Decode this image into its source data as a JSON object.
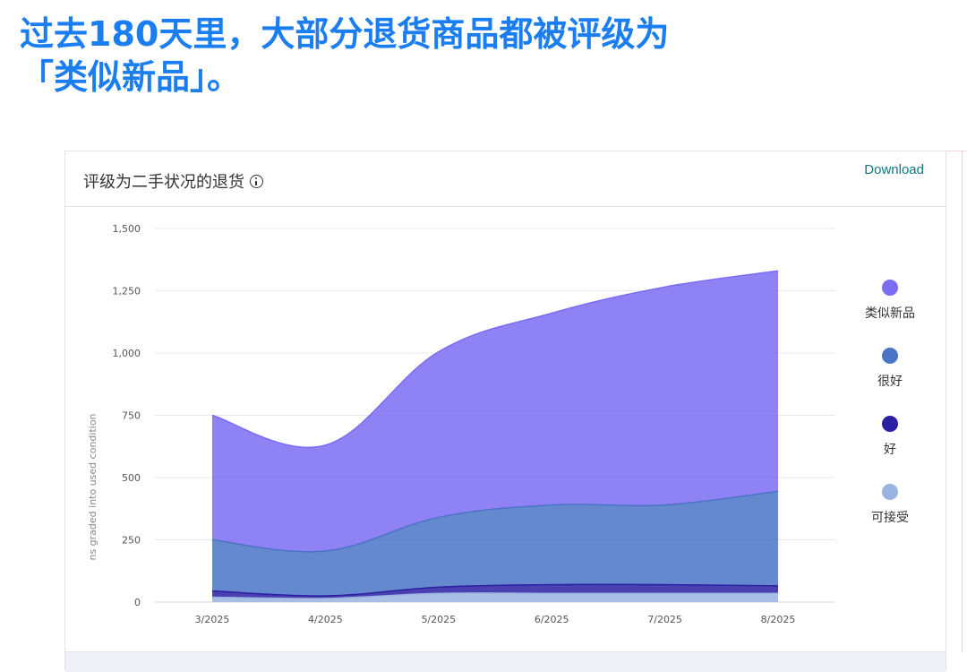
{
  "headline": {
    "line1": "过去180天里，大部分退货商品都被评级为",
    "line2": "「类似新品」。"
  },
  "card": {
    "title": "评级为二手状况的退货",
    "download_label": "Download"
  },
  "chart_data": {
    "type": "area",
    "stacked": true,
    "categories": [
      "3/2025",
      "4/2025",
      "5/2025",
      "6/2025",
      "7/2025",
      "8/2025"
    ],
    "ylabel": "ns graded into used condition",
    "ylim": [
      0,
      1500
    ],
    "yticks": [
      0,
      250,
      500,
      750,
      1000,
      1250,
      1500
    ],
    "ytick_labels": [
      "0",
      "250",
      "500",
      "750",
      "1,000",
      "1,250",
      "1,500"
    ],
    "grid": true,
    "legend_position": "right",
    "series": [
      {
        "name": "可接受",
        "color": "#9ab3e0",
        "values": [
          20,
          15,
          35,
          35,
          35,
          35
        ]
      },
      {
        "name": "好",
        "color": "#2b1fa3",
        "values": [
          25,
          10,
          25,
          35,
          35,
          30
        ]
      },
      {
        "name": "很好",
        "color": "#4a74c6",
        "values": [
          205,
          180,
          280,
          320,
          320,
          380
        ]
      },
      {
        "name": "类似新品",
        "color": "#7b6cf2",
        "values": [
          500,
          425,
          665,
          770,
          875,
          885
        ]
      }
    ]
  }
}
